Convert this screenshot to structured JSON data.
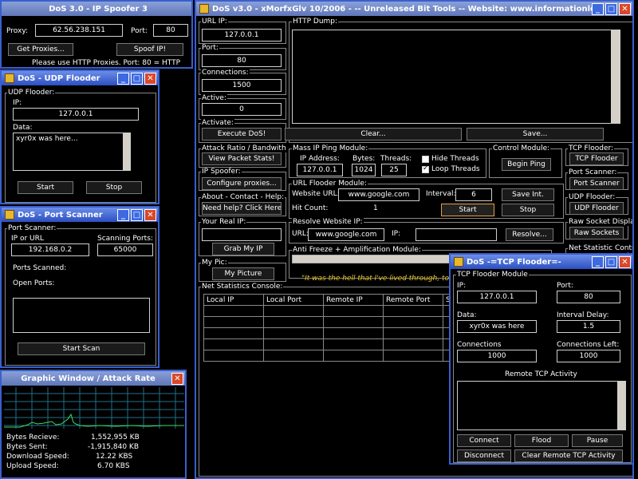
{
  "ip_spoofer": {
    "title": "DoS 3.0 - IP Spoofer 3",
    "proxy_label": "Proxy:",
    "proxy_value": "62.56.238.151",
    "port_label": "Port:",
    "port_value": "80",
    "get_proxies": "Get Proxies...",
    "spoof_ip": "Spoof IP!",
    "note": "Please use HTTP Proxies. Port: 80 = HTTP"
  },
  "udp_flooder": {
    "title": "DoS - UDP Flooder",
    "group": "UDP Flooder:",
    "ip_label": "IP:",
    "ip_value": "127.0.0.1",
    "data_label": "Data:",
    "data_value": "xyr0x was here...",
    "start": "Start",
    "stop": "Stop"
  },
  "port_scanner": {
    "title": "DoS - Port Scanner",
    "group": "Port Scanner:",
    "ip_label": "IP or URL",
    "ip_value": "192.168.0.2",
    "ports_label": "Scanning Ports:",
    "ports_value": "65000",
    "scanned_label": "Ports Scanned:",
    "open_label": "Open Ports:",
    "start_scan": "Start Scan"
  },
  "graph_win": {
    "title": "Graphic Window / Attack Rate",
    "stats": [
      {
        "label": "Bytes Recieve:",
        "value": "1,552,955 KB"
      },
      {
        "label": "Bytes Sent:",
        "value": "-1,915,840 KB"
      },
      {
        "label": "Download Speed:",
        "value": "12.22 KBS"
      },
      {
        "label": "Upload Speed:",
        "value": "6.70 KBS"
      }
    ],
    "line_color": "#3ddc5a",
    "grid_color": "#1f6f8a"
  },
  "main": {
    "title": "DoS v3.0 - xMorfxGlv 10/2006 - -- Unreleased Bit Tools -- Website: www.informationleak.net",
    "url_ip_group": "URL IP:",
    "url_ip_value": "127.0.0.1",
    "port_group": "Port:",
    "port_value": "80",
    "connections_group": "Connections:",
    "connections_value": "1500",
    "active_group": "Active:",
    "active_value": "0",
    "activate_group": "Activate:",
    "execute": "Execute DoS!",
    "http_dump_group": "HTTP Dump:",
    "clear": "Clear...",
    "save": "Save...",
    "attack_ratio_group": "Attack Ratio / Bandwith",
    "view_packet": "View Packet Stats!",
    "ip_spoofer_group": "IP Spoofer:",
    "configure_proxies": "Configure proxies...",
    "about_group": "About - Contact - Help:",
    "need_help": "Need help? Click Here",
    "real_ip_group": "Your Real IP:",
    "grab_ip": "Grab My IP",
    "my_pic_group": "My Pic:",
    "my_picture": "My Picture",
    "mass_ping_group": "Mass IP Ping Module:",
    "ping_ip_label": "IP Address:",
    "ping_ip_value": "127.0.0.1",
    "bytes_label": "Bytes:",
    "bytes_value": "1024",
    "threads_label": "Threads:",
    "threads_value": "25",
    "hide_threads": "Hide Threads",
    "loop_threads": "Loop Threads",
    "control_group": "Control Module:",
    "begin_ping": "Begin Ping",
    "url_flood_group": "URL Flooder Module:",
    "website_url_label": "Website URL:",
    "website_url_value": "www.google.com",
    "interval_label": "Interval:",
    "interval_value": "6",
    "save_int": "Save Int.",
    "hit_count_label": "Hit Count:",
    "hit_count_value": "1",
    "url_start": "Start",
    "url_stop": "Stop",
    "resolve_group": "Resolve Website IP:",
    "resolve_url_label": "URL:",
    "resolve_url_value": "www.google.com",
    "resolve_ip_label": "IP:",
    "resolve_btn": "Resolve...",
    "anti_freeze_group": "Anti Freeze + Amplification Module:",
    "quote": "\"It was the hell that I've lived through, to develop",
    "tcp_side_group": "TCP Flooder:",
    "tcp_side_btn": "TCP Flooder",
    "port_scan_group": "Port Scanner:",
    "port_scan_btn": "Port Scanner",
    "udp_side_group": "UDP Flooder:",
    "udp_side_btn": "UDP Flooder",
    "raw_socket_group": "Raw Socket Display:",
    "raw_socket_btn": "Raw Sockets",
    "net_stat_control_group": "Net Statistic Control:",
    "net_console_group": "Net Statistics Console:",
    "columns": [
      "Local IP",
      "Local Port",
      "Remote IP",
      "Remote Port",
      "S"
    ]
  },
  "tcp_flooder": {
    "title": "DoS -=TCP Flooder=-",
    "group": "TCP Flooder Module",
    "ip_label": "IP:",
    "ip_value": "127.0.0.1",
    "port_label": "Port:",
    "port_value": "80",
    "data_label": "Data:",
    "data_value": "xyr0x was here",
    "interval_label": "Interval Delay:",
    "interval_value": "1.5",
    "connections_label": "Connections",
    "connections_value": "1000",
    "left_label": "Connections Left:",
    "left_value": "1000",
    "activity_label": "Remote TCP Activity",
    "connect": "Connect",
    "flood": "Flood",
    "pause": "Pause",
    "disconnect": "Disconnect",
    "clear_activity": "Clear Remote TCP Activity"
  }
}
